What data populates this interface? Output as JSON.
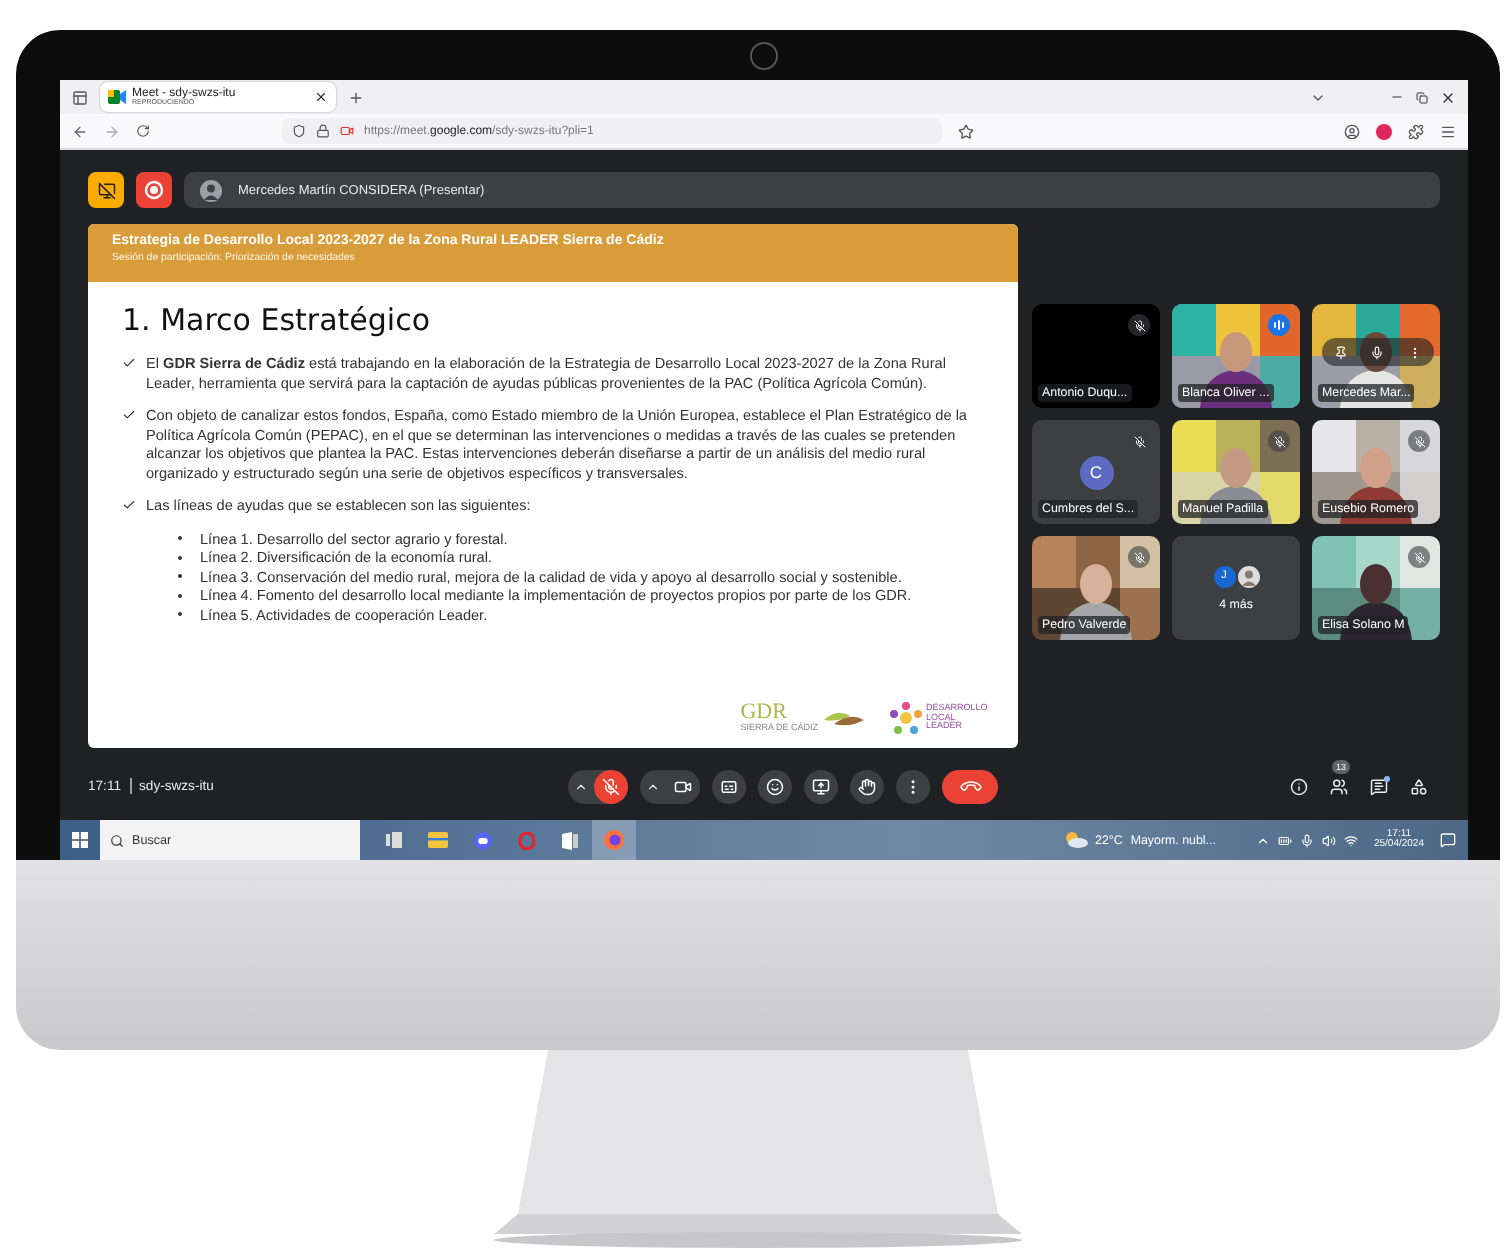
{
  "browser": {
    "tab": {
      "title": "Meet - sdy-swzs-itu",
      "subtitle": "REPRODUCIENDO"
    },
    "url": "https://meet.**google.com**/sdy-swzs-itu?pli=1"
  },
  "meet": {
    "presenter": "Mercedes Martín CONSIDERA (Presentar)",
    "slide": {
      "header_title": "Estrategia de Desarrollo Local 2023-2027 de la Zona Rural LEADER Sierra de Cádiz",
      "header_subtitle": "Sesión de participación:  Priorización de necesidades",
      "heading": "1. Marco Estratégico",
      "bullets": [
        "El **GDR Sierra de Cádiz** está trabajando en la elaboración de la Estrategia de Desarrollo Local 2023-2027 de la Zona Rural Leader, herramienta que servirá para la captación de ayudas públicas provenientes de la PAC (Política Agrícola Común).",
        "Con objeto de canalizar estos fondos, España, como Estado miembro de la Unión Europea, establece el Plan Estratégico de la Política Agrícola Común (PEPAC), en el que se determinan las intervenciones o medidas a través de las cuales se pretenden alcanzar los objetivos que plantea la PAC. Estas intervenciones deberán diseñarse a partir de un análisis del medio rural organizado y estructurado según una serie de objetivos específicos y transversales.",
        "Las líneas de ayudas que se establecen son las siguientes:"
      ],
      "lines": [
        "Línea 1. Desarrollo del sector agrario y forestal.",
        "Línea 2. Diversificación de la economía rural.",
        "Línea 3. Conservación del medio rural, mejora de la calidad de vida y apoyo al desarrollo social y sostenible.",
        "Línea 4. Fomento del desarrollo local mediante la implementación de proyectos propios por parte de los GDR.",
        "Línea 5. Actividades de cooperación Leader."
      ],
      "logos": [
        {
          "kind": "gdr",
          "text": "GDR",
          "subtitle": "SIERRA DE CÁDIZ"
        },
        {
          "kind": "leader",
          "text": "DESARROLLO LOCAL LEADER"
        }
      ]
    },
    "participants": [
      {
        "kind": "camera_off",
        "name": "Antonio Duqu...",
        "muted": true,
        "speaking": false,
        "hover_controls": false
      },
      {
        "kind": "video",
        "name": "Blanca Oliver ...",
        "muted": false,
        "speaking": true,
        "hover_controls": false
      },
      {
        "kind": "video",
        "name": "Mercedes Mar...",
        "muted": false,
        "speaking": false,
        "hover_controls": true
      },
      {
        "kind": "avatar",
        "initial": "C",
        "name": "Cumbres del S...",
        "muted": true,
        "speaking": false,
        "hover_controls": false
      },
      {
        "kind": "video",
        "name": "Manuel Padilla",
        "muted": true,
        "speaking": false,
        "hover_controls": false
      },
      {
        "kind": "video",
        "name": "Eusebio Romero",
        "muted": true,
        "speaking": false,
        "hover_controls": false
      },
      {
        "kind": "video",
        "name": "Pedro Valverde",
        "muted": true,
        "speaking": false,
        "hover_controls": false
      },
      {
        "kind": "more",
        "initial": "J",
        "name": "4 más"
      },
      {
        "kind": "video",
        "name": "Elisa Solano M",
        "muted": true,
        "speaking": false,
        "hover_controls": false
      }
    ],
    "meeting_time": "17:11",
    "meeting_code": "sdy-swzs-itu",
    "controls": [
      {
        "kind": "mic",
        "muted": true
      },
      {
        "kind": "camera"
      },
      {
        "kind": "captions"
      },
      {
        "kind": "emoji"
      },
      {
        "kind": "present"
      },
      {
        "kind": "hand"
      },
      {
        "kind": "more"
      },
      {
        "kind": "end"
      }
    ],
    "people_count": "13"
  },
  "taskbar": {
    "search_placeholder": "Buscar",
    "temperature": "22°C",
    "weather": "Mayorm. nubl...",
    "time": "17:11",
    "date": "25/04/2024"
  }
}
